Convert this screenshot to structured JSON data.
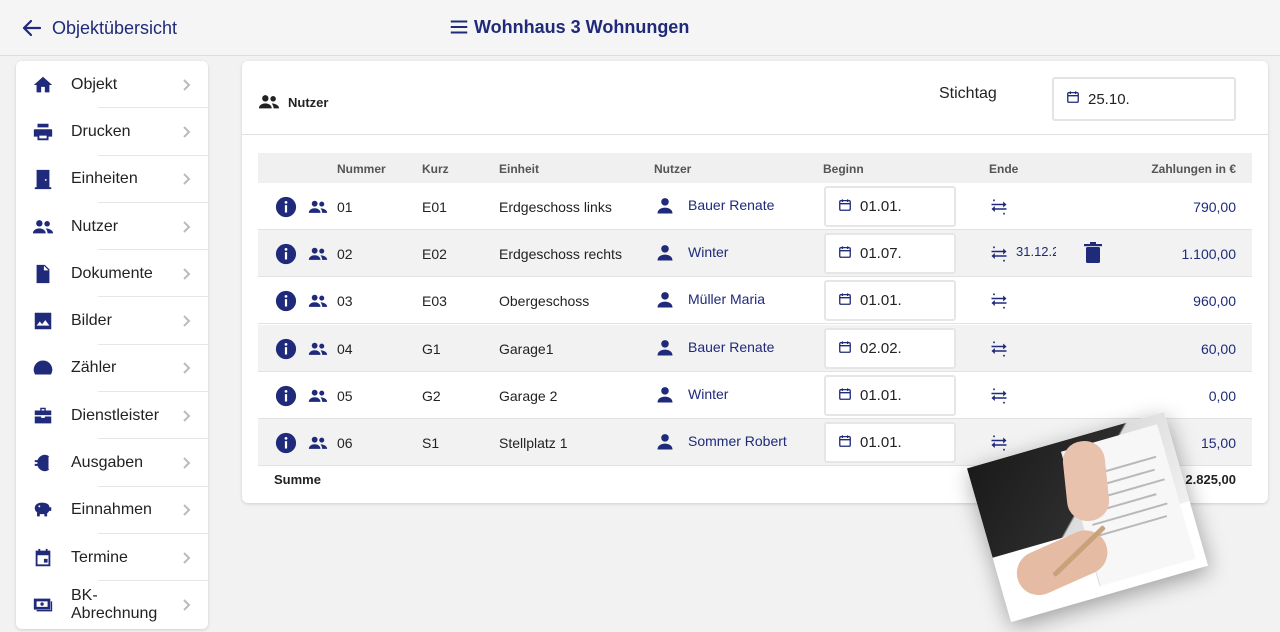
{
  "header": {
    "back_label": "Objektübersicht",
    "title": "Wohnhaus 3 Wohnungen"
  },
  "sidebar": {
    "items": [
      {
        "label": "Objekt",
        "icon": "home-icon"
      },
      {
        "label": "Drucken",
        "icon": "printer-icon"
      },
      {
        "label": "Einheiten",
        "icon": "door-icon"
      },
      {
        "label": "Nutzer",
        "icon": "users-icon"
      },
      {
        "label": "Dokumente",
        "icon": "document-icon"
      },
      {
        "label": "Bilder",
        "icon": "image-icon"
      },
      {
        "label": "Zähler",
        "icon": "gauge-icon"
      },
      {
        "label": "Dienstleister",
        "icon": "briefcase-icon"
      },
      {
        "label": "Ausgaben",
        "icon": "euro-icon"
      },
      {
        "label": "Einnahmen",
        "icon": "piggy-bank-icon"
      },
      {
        "label": "Termine",
        "icon": "calendar-icon"
      },
      {
        "label": "BK-Abrechnung",
        "icon": "billing-icon"
      }
    ]
  },
  "panel": {
    "title": "Nutzer",
    "stichtag_label": "Stichtag",
    "stichtag_value": "25.10.",
    "columns": {
      "nummer": "Nummer",
      "kurz": "Kurz",
      "einheit": "Einheit",
      "nutzer": "Nutzer",
      "beginn": "Beginn",
      "ende": "Ende",
      "zahlungen": "Zahlungen in €"
    },
    "rows": [
      {
        "nummer": "01",
        "kurz": "E01",
        "einheit": "Erdgeschoss links",
        "nutzer": "Bauer Renate",
        "beginn": "01.01.",
        "ende": "",
        "zahlungen": "790,00"
      },
      {
        "nummer": "02",
        "kurz": "E02",
        "einheit": "Erdgeschoss rechts",
        "nutzer": "Winter",
        "beginn": "01.07.",
        "ende": "31.12.2",
        "zahlungen": "1.100,00"
      },
      {
        "nummer": "03",
        "kurz": "E03",
        "einheit": "Obergeschoss",
        "nutzer": "Müller Maria",
        "beginn": "01.01.",
        "ende": "",
        "zahlungen": "960,00"
      },
      {
        "nummer": "04",
        "kurz": "G1",
        "einheit": "Garage1",
        "nutzer": "Bauer Renate",
        "beginn": "02.02.",
        "ende": "",
        "zahlungen": "60,00"
      },
      {
        "nummer": "05",
        "kurz": "G2",
        "einheit": "Garage 2",
        "nutzer": "Winter",
        "beginn": "01.01.",
        "ende": "",
        "zahlungen": "0,00"
      },
      {
        "nummer": "06",
        "kurz": "S1",
        "einheit": "Stellplatz 1",
        "nutzer": "Sommer Robert",
        "beginn": "01.01.",
        "ende": "",
        "zahlungen": "15,00"
      }
    ],
    "summe_label": "Summe",
    "summe_value": "2.825,00"
  },
  "colors": {
    "accent": "#1f2a7a",
    "background": "#f2f2f2"
  }
}
